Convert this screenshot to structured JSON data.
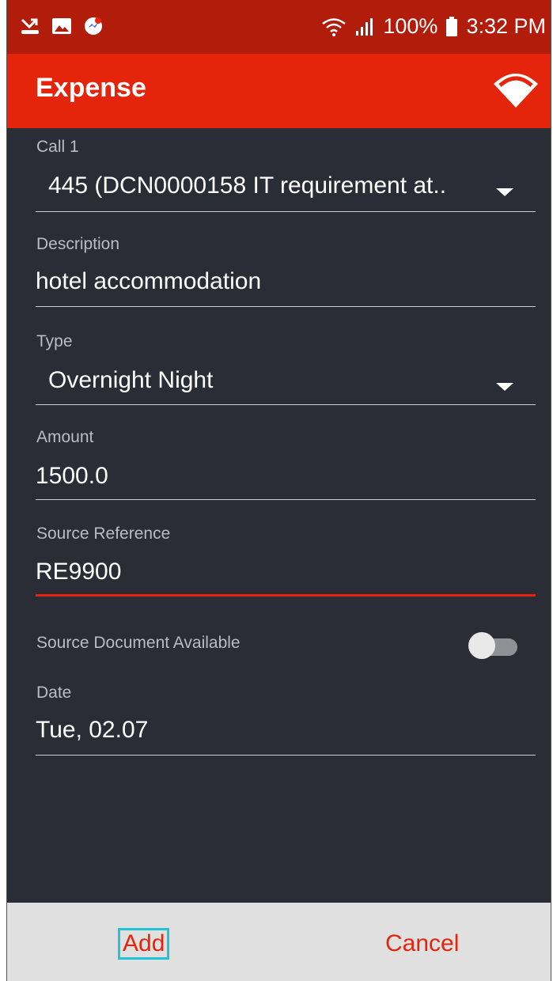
{
  "status_bar": {
    "battery": "100%",
    "time": "3:32 PM",
    "icons": [
      "missed-call-icon",
      "image-icon",
      "messenger-icon",
      "wifi-icon",
      "signal-icon",
      "battery-icon"
    ]
  },
  "app_bar": {
    "title": "Expense",
    "logo_icon": "wifi-logo-icon"
  },
  "form": {
    "call": {
      "label": "Call 1",
      "value": "445 (DCN0000158 IT requirement at.."
    },
    "description": {
      "label": "Description",
      "value": "hotel accommodation"
    },
    "type": {
      "label": "Type",
      "value": "Overnight Night"
    },
    "amount": {
      "label": "Amount",
      "value": "1500.0"
    },
    "source_reference": {
      "label": "Source Reference",
      "value": "RE9900"
    },
    "source_document": {
      "label": "Source Document Available",
      "checked": false
    },
    "date": {
      "label": "Date",
      "value": "Tue, 02.07"
    }
  },
  "actions": {
    "add_label": "Add",
    "cancel_label": "Cancel"
  },
  "colors": {
    "status_bar": "#b21c0a",
    "accent": "#e4250b",
    "background": "#2b2d36",
    "focus_outline": "#20c4d4"
  }
}
